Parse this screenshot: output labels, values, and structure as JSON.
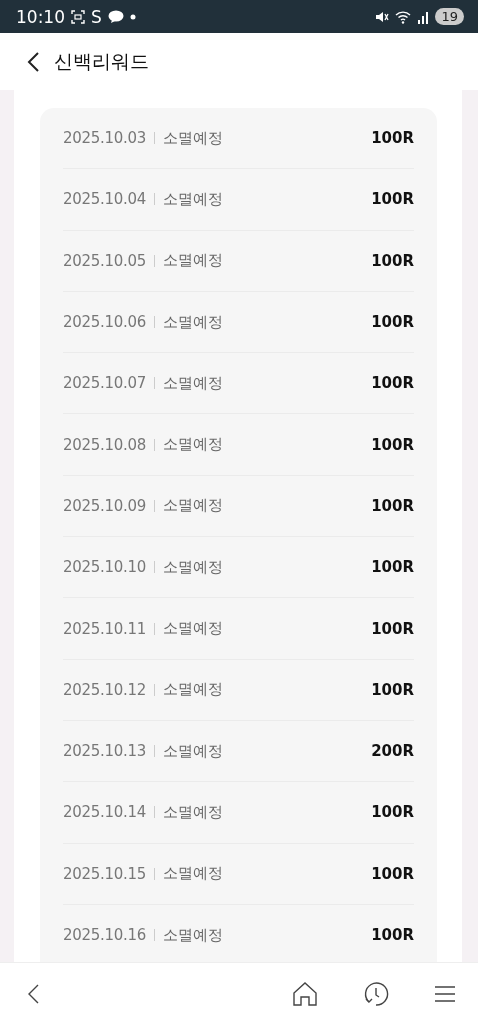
{
  "status_bar": {
    "time": "10:10",
    "app_letter": "S",
    "battery": "19"
  },
  "header": {
    "title": "신백리워드"
  },
  "rows": [
    {
      "date": "2025.10.03",
      "status": "소멸예정",
      "amount": "100R"
    },
    {
      "date": "2025.10.04",
      "status": "소멸예정",
      "amount": "100R"
    },
    {
      "date": "2025.10.05",
      "status": "소멸예정",
      "amount": "100R"
    },
    {
      "date": "2025.10.06",
      "status": "소멸예정",
      "amount": "100R"
    },
    {
      "date": "2025.10.07",
      "status": "소멸예정",
      "amount": "100R"
    },
    {
      "date": "2025.10.08",
      "status": "소멸예정",
      "amount": "100R"
    },
    {
      "date": "2025.10.09",
      "status": "소멸예정",
      "amount": "100R"
    },
    {
      "date": "2025.10.10",
      "status": "소멸예정",
      "amount": "100R"
    },
    {
      "date": "2025.10.11",
      "status": "소멸예정",
      "amount": "100R"
    },
    {
      "date": "2025.10.12",
      "status": "소멸예정",
      "amount": "100R"
    },
    {
      "date": "2025.10.13",
      "status": "소멸예정",
      "amount": "200R"
    },
    {
      "date": "2025.10.14",
      "status": "소멸예정",
      "amount": "100R"
    },
    {
      "date": "2025.10.15",
      "status": "소멸예정",
      "amount": "100R"
    },
    {
      "date": "2025.10.16",
      "status": "소멸예정",
      "amount": "100R"
    }
  ]
}
